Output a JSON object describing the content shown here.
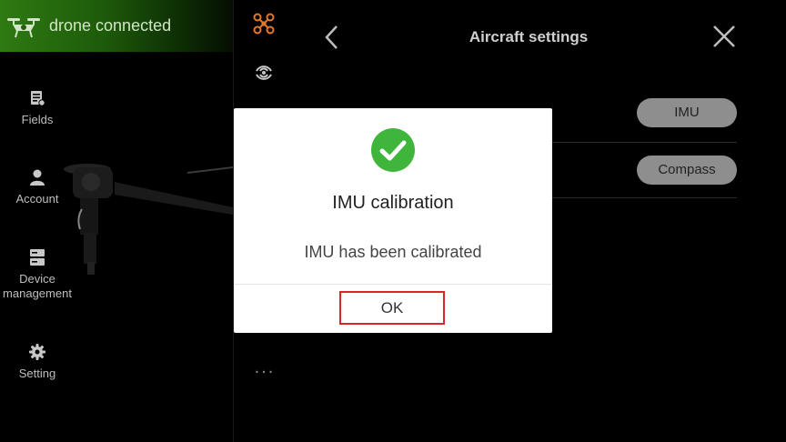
{
  "connection": {
    "status_text": "drone connected",
    "icon": "drone-icon"
  },
  "sidebar": {
    "items": [
      {
        "label": "Fields",
        "icon": "fields-icon"
      },
      {
        "label": "Account",
        "icon": "account-icon"
      },
      {
        "label": "Device\nmanagement",
        "icon": "device-icon"
      },
      {
        "label": "Setting",
        "icon": "gear-icon"
      }
    ]
  },
  "icon_column": {
    "icons": [
      "quadcopter-icon",
      "signal-icon"
    ],
    "more": "..."
  },
  "panel": {
    "title": "Aircraft settings",
    "rows": [
      {
        "button": "IMU"
      },
      {
        "button": "Compass"
      }
    ]
  },
  "dialog": {
    "title": "IMU calibration",
    "message": "IMU has been calibrated",
    "ok_label": "OK"
  },
  "colors": {
    "banner_green": "#2f7a12",
    "success_green": "#3fb53c",
    "highlight_red": "#d8262b",
    "quad_orange": "#e07a2a"
  }
}
